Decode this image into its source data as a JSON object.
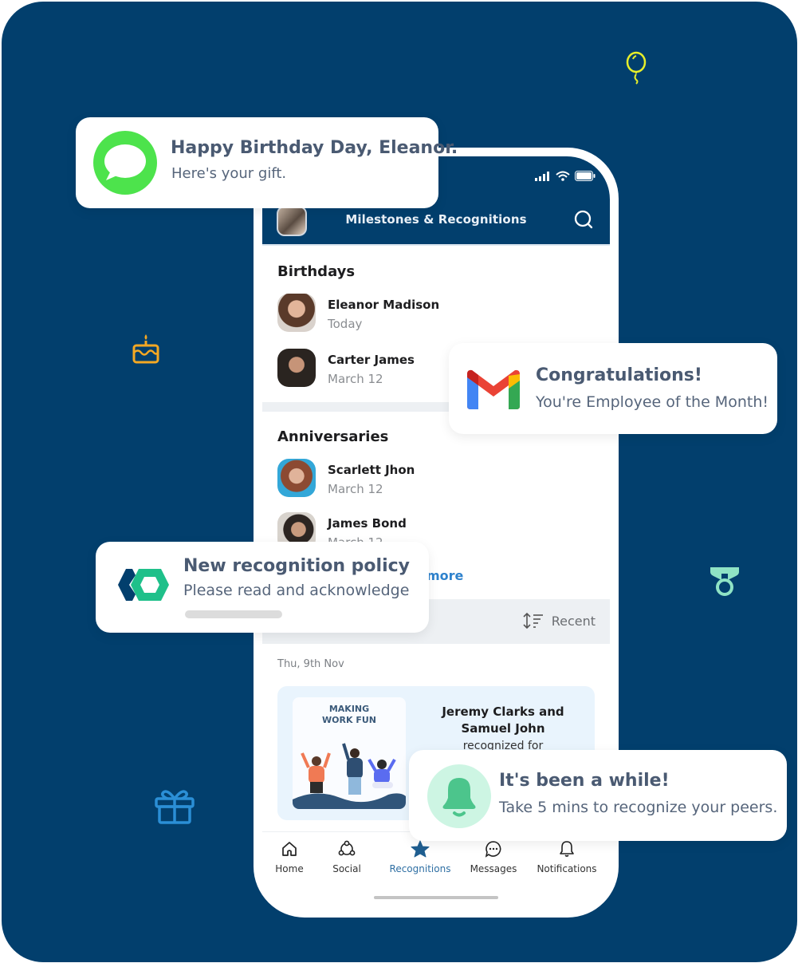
{
  "colors": {
    "background": "#023f6d",
    "accent_blue": "#2e82cd",
    "active_nav": "#2f6fa3",
    "notification_title": "#4a5a72",
    "imessage_green": "#4de34c",
    "bell_green": "#4cc58c",
    "bell_bg": "#cdf5e3"
  },
  "decorations": [
    "balloon-icon",
    "cake-icon",
    "medal-icon",
    "gift-icon"
  ],
  "phone": {
    "status_icons": [
      "signal-icon",
      "wifi-icon",
      "battery-icon"
    ],
    "header": {
      "title": "Milestones & Recognitions",
      "search_icon": "search-icon"
    },
    "birthdays": {
      "title": "Birthdays",
      "people": [
        {
          "name": "Eleanor Madison",
          "date": "Today"
        },
        {
          "name": "Carter James",
          "date": "March 12"
        }
      ]
    },
    "anniversaries": {
      "title": "Anniversaries",
      "people": [
        {
          "name": "Scarlett Jhon",
          "date": "March 12"
        },
        {
          "name": "James Bond",
          "date": "March 12"
        }
      ],
      "see_more": "more"
    },
    "sort": {
      "label": "Recent",
      "icon": "sort-icon"
    },
    "feed": {
      "date": "Thu, 9th Nov",
      "card": {
        "image_caption_line1": "MAKING",
        "image_caption_line2": "WORK FUN",
        "names": "Jeremy Clarks and Samuel John",
        "subtitle": "recognized for"
      }
    },
    "bottom_nav": [
      {
        "label": "Home",
        "icon": "home-icon",
        "active": false
      },
      {
        "label": "Social",
        "icon": "social-icon",
        "active": false
      },
      {
        "label": "Recognitions",
        "icon": "star-icon",
        "active": true
      },
      {
        "label": "Messages",
        "icon": "message-icon",
        "active": false
      },
      {
        "label": "Notifications",
        "icon": "bell-icon",
        "active": false
      }
    ]
  },
  "notifications": [
    {
      "app": "imessage",
      "title": "Happy Birthday Day, Eleanor.",
      "body": "Here's your gift."
    },
    {
      "app": "gmail",
      "title": "Congratulations!",
      "body": "You're Employee of the Month!"
    },
    {
      "app": "policy",
      "title": "New recognition policy",
      "body": "Please read and acknowledge"
    },
    {
      "app": "reminder",
      "title": "It's been a while!",
      "body": "Take 5 mins to recognize your peers."
    }
  ]
}
